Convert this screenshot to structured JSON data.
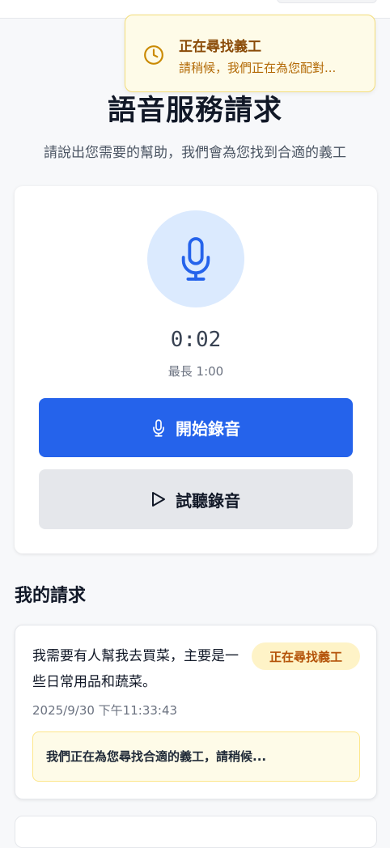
{
  "toast": {
    "title": "正在尋找義工",
    "message": "請稍候，我們正在為您配對..."
  },
  "header": {
    "title": "語音服務請求",
    "subtitle": "請說出您需要的幫助，我們會為您找到合適的義工"
  },
  "recorder": {
    "timer": "0:02",
    "max_label": "最長 1:00",
    "record_button": "開始錄音",
    "play_button": "試聽錄音"
  },
  "requests": {
    "section_title": "我的請求",
    "items": [
      {
        "text": "我需要有人幫我去買菜，主要是一些日常用品和蔬菜。",
        "status": "正在尋找義工",
        "timestamp": "2025/9/30 下午11:33:43",
        "note": "我們正在為您尋找合適的義工，請稍候..."
      }
    ]
  },
  "colors": {
    "primary": "#2563eb",
    "mic_bg": "#dbeafe",
    "toast_bg": "#fefbe8",
    "toast_title": "#8a4b08",
    "badge_bg": "#fef3c7",
    "badge_text": "#b45309"
  },
  "icons": {
    "toast": "clock-icon",
    "recorder": "microphone-icon",
    "record_button": "microphone-icon",
    "play_button": "play-icon"
  }
}
